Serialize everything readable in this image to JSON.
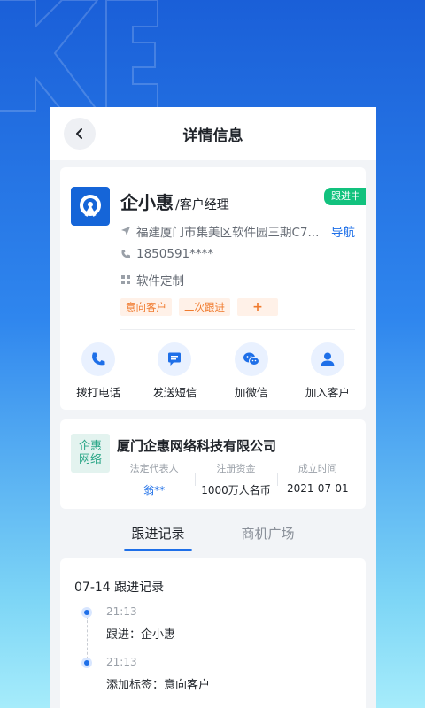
{
  "header": {
    "title": "详情信息"
  },
  "contact": {
    "name": "企小惠",
    "role": "/客户经理",
    "status": "跟进中",
    "address": "福建厦门市集美区软件园三期C7...",
    "nav_label": "导航",
    "phone": "1850591****",
    "business": "软件定制",
    "tags": [
      "意向客户",
      "二次跟进"
    ],
    "tag_add": "+"
  },
  "actions": [
    {
      "label": "拨打电话",
      "icon": "phone-icon"
    },
    {
      "label": "发送短信",
      "icon": "message-icon"
    },
    {
      "label": "加微信",
      "icon": "wechat-icon"
    },
    {
      "label": "加入客户",
      "icon": "user-icon"
    }
  ],
  "company": {
    "logo_line1": "企惠",
    "logo_line2": "网络",
    "name": "厦门企惠网络科技有限公司",
    "stats": [
      {
        "label": "法定代表人",
        "value": "翁**"
      },
      {
        "label": "注册资金",
        "value": "1000万人名币"
      },
      {
        "label": "成立时间",
        "value": "2021-07-01"
      }
    ]
  },
  "tabs": [
    {
      "label": "跟进记录",
      "active": true
    },
    {
      "label": "商机广场",
      "active": false
    }
  ],
  "records": {
    "title": "07-14 跟进记录",
    "items": [
      {
        "time": "21:13",
        "text": "跟进：企小惠"
      },
      {
        "time": "21:13",
        "text": "添加标签：意向客户"
      }
    ]
  },
  "colors": {
    "accent": "#1e6fe8",
    "status_green": "#12c27e",
    "tag_orange": "#f07b2f"
  }
}
